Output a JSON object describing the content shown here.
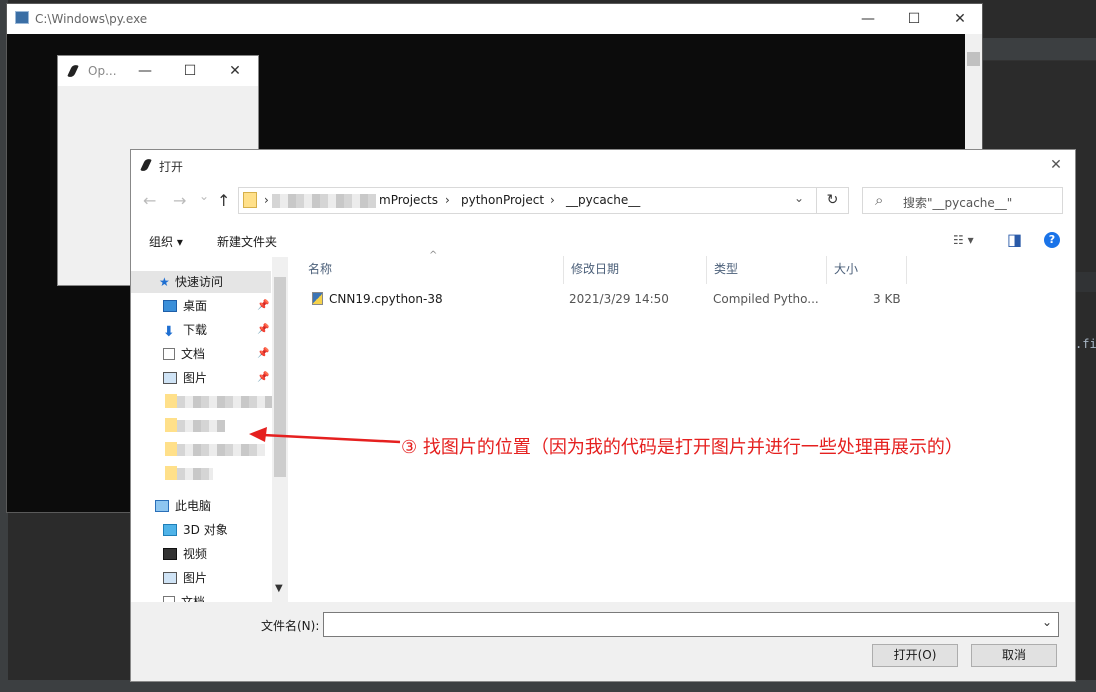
{
  "console": {
    "title": "C:\\Windows\\py.exe",
    "controls": [
      "—",
      "☐",
      "✕"
    ]
  },
  "tk_window": {
    "title": "Op...",
    "controls": [
      "—",
      "☐",
      "✕"
    ]
  },
  "dialog": {
    "title": "打开",
    "close": "✕",
    "nav": {
      "back": "←",
      "forward": "→",
      "dropdown": "⌄",
      "up": "↑"
    },
    "address": {
      "sep": "›",
      "crumbs": [
        "mProjects",
        "pythonProject",
        "__pycache__"
      ],
      "seps": [
        "›",
        "›",
        "›"
      ],
      "dropdown": "⌄",
      "refresh": "↻"
    },
    "search": {
      "icon": "⌕",
      "placeholder": "搜索\"__pycache__\""
    },
    "toolbar": {
      "organize": "组织 ▾",
      "new_folder": "新建文件夹",
      "view": "☷ ▾",
      "pane": "◨",
      "help": "?"
    },
    "nav_items": {
      "quick_access": "快速访问",
      "desktop": "桌面",
      "downloads": "下载",
      "documents": "文档",
      "pictures": "图片",
      "this_pc": "此电脑",
      "objects_3d": "3D 对象",
      "videos": "视频",
      "pictures2": "图片",
      "documents2": "文档"
    },
    "pin": "📌",
    "columns": {
      "name": "名称",
      "modified": "修改日期",
      "type": "类型",
      "size": "大小",
      "sort": "^"
    },
    "files": [
      {
        "name": "CNN19.cpython-38",
        "modified": "2021/3/29 14:50",
        "type": "Compiled Pytho...",
        "size": "3 KB"
      }
    ],
    "filename_label": "文件名(N):",
    "filename_value": "",
    "filename_dropdown": "⌄",
    "open_button": "打开(O)",
    "cancel_button": "取消"
  },
  "annotation": "③ 找图片的位置（因为我的代码是打开图片并进行一些处理再展示的）",
  "ide_fragment": ".fi",
  "colors": {
    "annotation": "#e5201f",
    "console_bg": "#0c0c0c",
    "help": "#1a73e8"
  }
}
